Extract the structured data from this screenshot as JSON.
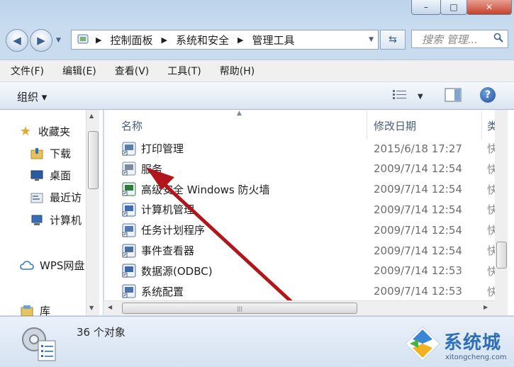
{
  "window": {
    "caption": {
      "minimize": "–",
      "maximize": "□",
      "close": "✕"
    }
  },
  "nav": {
    "breadcrumb": [
      "控制面板",
      "系统和安全",
      "管理工具"
    ],
    "search_placeholder": "搜索 管理..."
  },
  "menubar": {
    "items": [
      "文件(F)",
      "编辑(E)",
      "查看(V)",
      "工具(T)",
      "帮助(H)"
    ]
  },
  "toolbar": {
    "organize_label": "组织 ▾",
    "help": "?"
  },
  "navpane": {
    "items": [
      {
        "label": "收藏夹",
        "icon": "star-icon"
      },
      {
        "label": "下载",
        "icon": "download-folder-icon"
      },
      {
        "label": "桌面",
        "icon": "desktop-icon"
      },
      {
        "label": "最近访",
        "icon": "recent-places-icon"
      },
      {
        "label": "计算机",
        "icon": "computer-icon"
      },
      {
        "label": "WPS网盘",
        "icon": "cloud-icon"
      },
      {
        "label": "库",
        "icon": "library-icon"
      }
    ]
  },
  "filelist": {
    "columns": {
      "name": "名称",
      "date": "修改日期",
      "extra": "类"
    },
    "rows": [
      {
        "name": "打印管理",
        "date": "2015/6/18 17:27",
        "extra": "快"
      },
      {
        "name": "服务",
        "date": "2009/7/14 12:54",
        "extra": "快"
      },
      {
        "name": "高级安全 Windows 防火墙",
        "date": "2009/7/14 12:54",
        "extra": "快"
      },
      {
        "name": "计算机管理",
        "date": "2009/7/14 12:54",
        "extra": "快"
      },
      {
        "name": "任务计划程序",
        "date": "2009/7/14 12:54",
        "extra": "快"
      },
      {
        "name": "事件查看器",
        "date": "2009/7/14 12:54",
        "extra": "快"
      },
      {
        "name": "数据源(ODBC)",
        "date": "2009/7/14 12:53",
        "extra": "快"
      },
      {
        "name": "系统配置",
        "date": "2009/7/14 12:53",
        "extra": "快"
      }
    ]
  },
  "status": {
    "count": "36 个对象"
  },
  "watermark": {
    "brand": "系统城",
    "url": "xitongcheng.com"
  },
  "colors": {
    "annotation_arrow": "#b0161c",
    "accent_blue": "#2f6fb7"
  }
}
